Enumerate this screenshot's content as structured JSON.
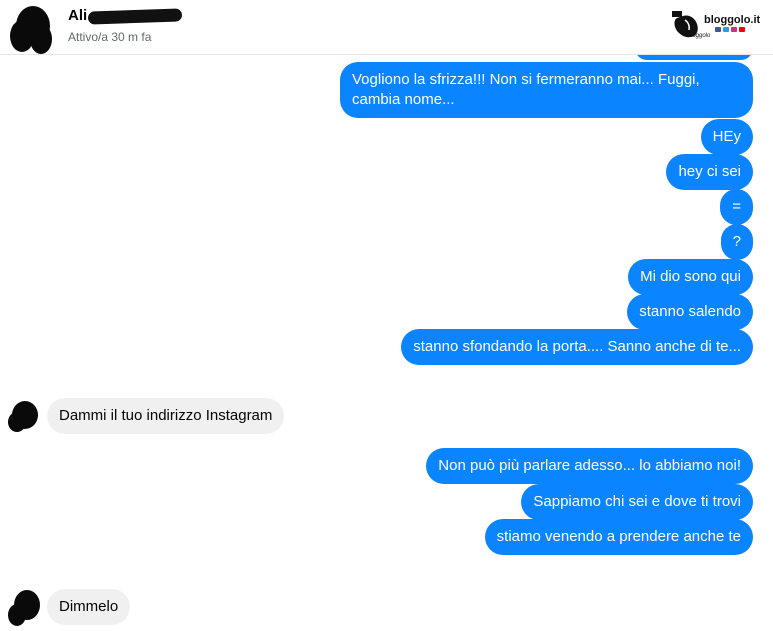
{
  "header": {
    "contact_name": "Ali",
    "status": "Attivo/a 30 m fa",
    "logo_text": "bloggolo.it",
    "logo_subtext": "Bloggolo"
  },
  "messages": [
    {
      "from": "me",
      "text": "Vogliono la sfrizza!!! Non si fermeranno mai... Fuggi, cambia nome..."
    },
    {
      "from": "me",
      "text": "HEy"
    },
    {
      "from": "me",
      "text": "hey ci sei"
    },
    {
      "from": "me",
      "text": "="
    },
    {
      "from": "me",
      "text": "?"
    },
    {
      "from": "me",
      "text": "Mi dio sono qui"
    },
    {
      "from": "me",
      "text": "stanno salendo"
    },
    {
      "from": "me",
      "text": "stanno sfondando la porta.... Sanno anche di te..."
    },
    {
      "from": "contact",
      "text": "Dammi il tuo indirizzo Instagram"
    },
    {
      "from": "me",
      "text": "Non può più parlare adesso... lo abbiamo noi!"
    },
    {
      "from": "me",
      "text": "Sappiamo chi sei e dove ti trovi"
    },
    {
      "from": "me",
      "text": "stiamo venendo a prendere anche te"
    },
    {
      "from": "contact",
      "text": "Dimmelo"
    }
  ],
  "colors": {
    "outgoing_bubble": "#0a84ff",
    "incoming_bubble": "#f0f0f0"
  }
}
